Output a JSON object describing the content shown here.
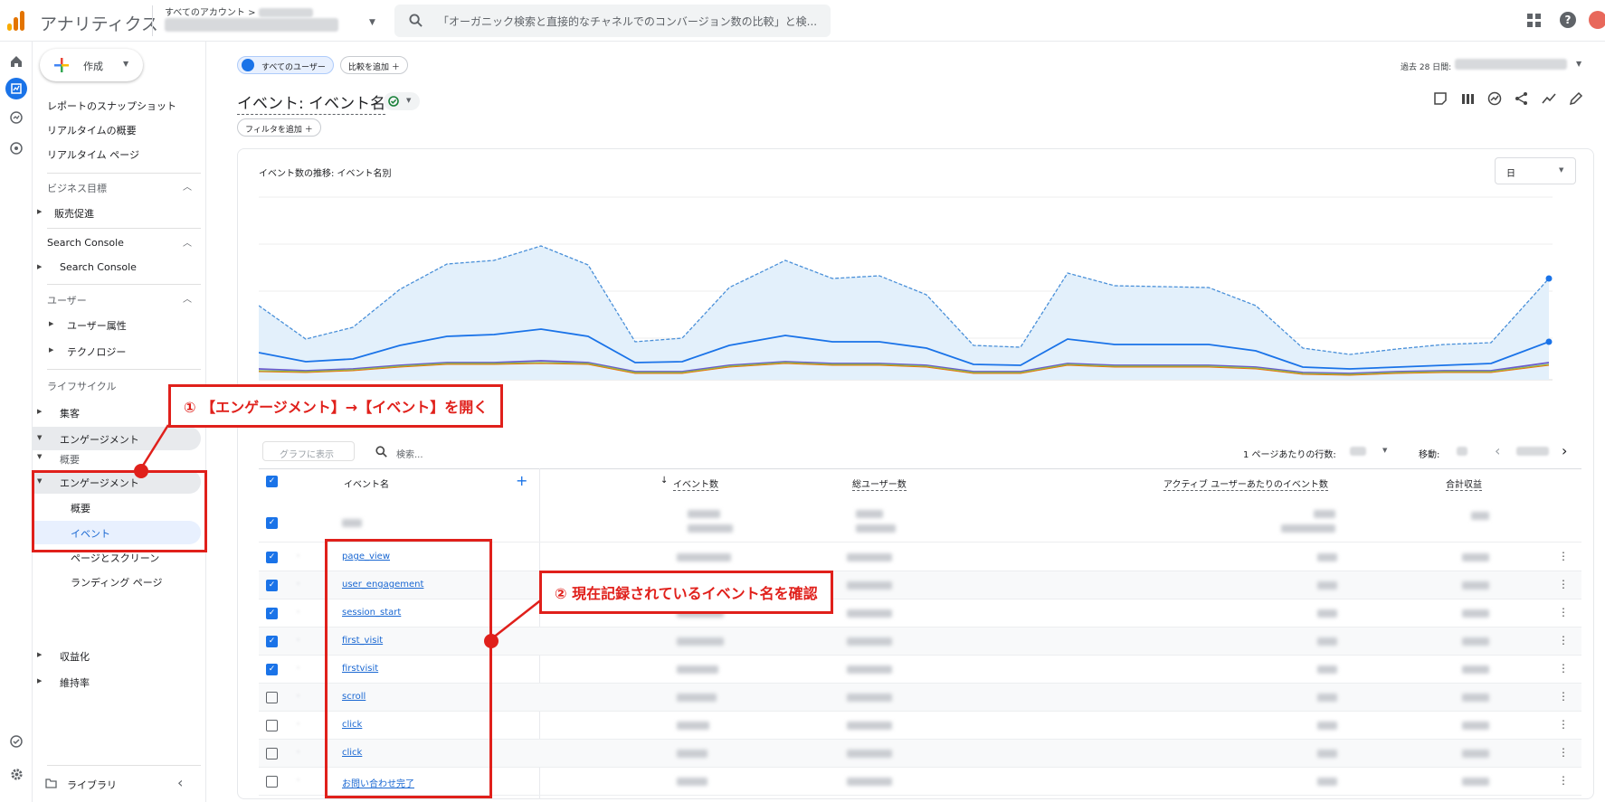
{
  "app": {
    "title": "アナリティクス",
    "account_prefix": "すべてのアカウント >"
  },
  "search": {
    "placeholder": "「オーガニック検索と直接的なチャネルでのコンバージョン数の比較」と検..."
  },
  "sidebar": {
    "create_label": "作成",
    "top_items": [
      "レポートのスナップショット",
      "リアルタイムの概要",
      "リアルタイム ページ"
    ],
    "section_business": "ビジネス目標",
    "item_sales": "販売促進",
    "section_search_console": "Search Console",
    "item_search_console": "Search Console",
    "section_user": "ユーザー",
    "item_user_attr": "ユーザー属性",
    "item_tech": "テクノロジー",
    "section_lifecycle": "ライフサイクル",
    "item_acquisition": "集客",
    "item_engagement": "エンゲージメント",
    "item_overview_top": "概要",
    "item_engagement_sub": "エンゲージメント",
    "item_overview": "概要",
    "item_events": "イベント",
    "item_pages": "ページとスクリーン",
    "item_landing": "ランディング ページ",
    "item_monetization": "収益化",
    "item_retention": "維持率",
    "library": "ライブラリ"
  },
  "header": {
    "chip_all_users": "すべてのユーザー",
    "chip_add_compare": "比較を追加",
    "date_label": "過去 28 日間:",
    "page_title": "イベント: イベント名",
    "filter_chip": "フィルタを追加"
  },
  "chart": {
    "title": "イベント数の推移: イベント名別",
    "granularity": "日"
  },
  "table": {
    "plot_button": "グラフに表示",
    "search_placeholder": "検索...",
    "rows_per_page_label": "1 ページあたりの行数:",
    "goto_label": "移動:",
    "col_event_name": "イベント名",
    "col_event_count": "イベント数",
    "col_total_users": "総ユーザー数",
    "col_events_per_user": "アクティブ ユーザーあたりのイベント数",
    "col_revenue": "合計収益",
    "rows": [
      {
        "name": "page_view",
        "checked": true
      },
      {
        "name": "user_engagement",
        "checked": true
      },
      {
        "name": "session_start",
        "checked": true
      },
      {
        "name": "first_visit",
        "checked": true
      },
      {
        "name": "firstvisit",
        "checked": true
      },
      {
        "name": "scroll",
        "checked": false
      },
      {
        "name": "click",
        "checked": false
      },
      {
        "name": "click",
        "checked": false
      },
      {
        "name": "お問い合わせ完了",
        "checked": false
      }
    ]
  },
  "annotations": {
    "step1": "① 【エンゲージメント】→【イベント】を開く",
    "step2": "② 現在記録されているイベント名を確認"
  },
  "colors": {
    "accent": "#1a73e8",
    "annotation": "#e0201b",
    "chart_fill": "#e3f0fb"
  }
}
